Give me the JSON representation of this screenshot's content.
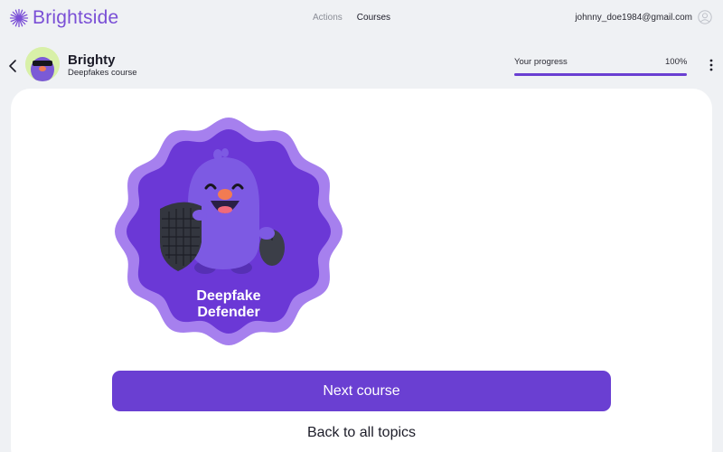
{
  "app": {
    "brand": "Brightside",
    "nav": [
      {
        "label": "Actions",
        "active": false
      },
      {
        "label": "Courses",
        "active": true
      }
    ],
    "user_email": "johnny_doe1984@gmail.com",
    "accent_color": "#6a3fd2"
  },
  "course": {
    "title": "Brighty",
    "subtitle": "Deepfakes course",
    "progress_label": "Your progress",
    "progress_value": "100%",
    "progress_fraction": 1.0
  },
  "badge": {
    "line1": "Deepfake",
    "line2": "Defender",
    "icon": "mascot-shield-mouse-badge"
  },
  "actions": {
    "next_label": "Next course",
    "back_label": "Back to all topics"
  }
}
